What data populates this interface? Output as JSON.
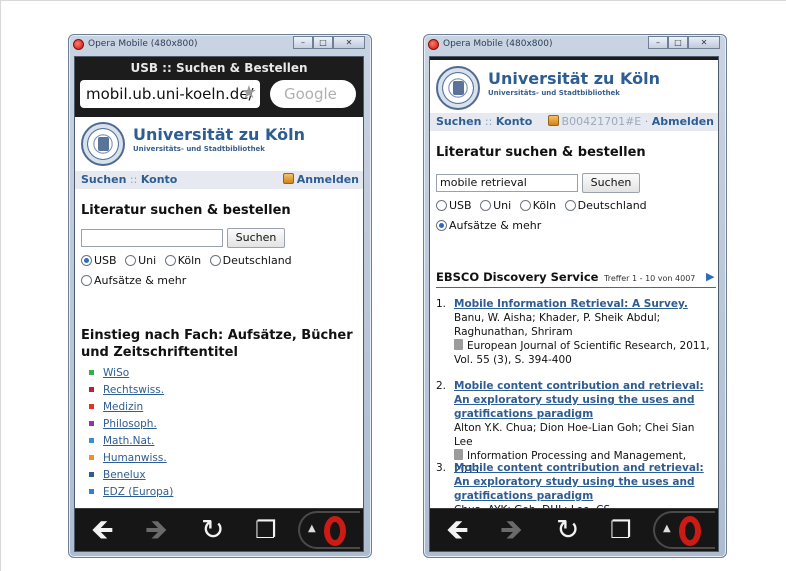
{
  "left_window": {
    "title": "Opera Mobile (480x800)",
    "controls": [
      "–",
      "□",
      "✕"
    ],
    "page_title": "USB :: Suchen & Bestellen",
    "url": "mobil.ub.uni-koeln.de/",
    "search_placeholder": "Google",
    "header": {
      "name": "Universität zu Köln",
      "subtitle": "Universitäts- und Stadtbibliothek"
    },
    "nav": {
      "suchen": "Suchen",
      "separator": "::",
      "konto": "Konto",
      "login": "Anmelden"
    },
    "search": {
      "heading": "Literatur suchen & bestellen",
      "input_value": "",
      "button": "Suchen",
      "options": [
        "USB",
        "Uni",
        "Köln",
        "Deutschland"
      ],
      "extra_option": "Aufsätze & mehr",
      "selected": "USB"
    },
    "subjects": {
      "heading": "Einstieg nach Fach: Aufsätze, Bücher und Zeitschriftentitel",
      "items": [
        {
          "label": "WiSo",
          "color": "#2eb24a"
        },
        {
          "label": "Rechtswiss.",
          "color": "#b3243a"
        },
        {
          "label": "Medizin",
          "color": "#e3322e"
        },
        {
          "label": "Philosoph.",
          "color": "#8a3a9c"
        },
        {
          "label": "Math.Nat.",
          "color": "#3b8fd1"
        },
        {
          "label": "Humanwiss.",
          "color": "#f0902a"
        },
        {
          "label": "Benelux",
          "color": "#2e5d93"
        },
        {
          "label": "EDZ (Europa)",
          "color": "#3b7bd1"
        }
      ]
    }
  },
  "right_window": {
    "title": "Opera Mobile (480x800)",
    "controls": [
      "–",
      "□",
      "✕"
    ],
    "header": {
      "name": "Universität zu Köln",
      "subtitle": "Universitäts- und Stadtbibliothek"
    },
    "nav": {
      "suchen": "Suchen",
      "separator": "::",
      "konto": "Konto",
      "user_id": "B00421701#E",
      "dot": "·",
      "logout": "Abmelden"
    },
    "search": {
      "heading": "Literatur suchen & bestellen",
      "input_value": "mobile retrieval",
      "button": "Suchen",
      "options": [
        "USB",
        "Uni",
        "Köln",
        "Deutschland"
      ],
      "extra_option": "Aufsätze & mehr",
      "selected": "Aufsätze & mehr"
    },
    "results": {
      "service": "EBSCO Discovery Service",
      "count": "Treffer 1 - 10 von 4007",
      "items": [
        {
          "num": "1.",
          "title": "Mobile Information Retrieval: A Survey.",
          "authors": "Banu, W. Aisha; Khader, P. Sheik Abdul; Raghunathan, Shriram",
          "source": "European Journal of Scientific Research, 2011, Vol. 55 (3), S. 394-400"
        },
        {
          "num": "2.",
          "title": "Mobile content contribution and retrieval: An exploratory study using the uses and gratifications paradigm",
          "authors": "Alton Y.K. Chua; Dion Hoe-Lian Goh; Chei Sian Lee",
          "source": "Information Processing and Management, 2011"
        },
        {
          "num": "3.",
          "title": "Mobile content contribution and retrieval: An exploratory study using the uses and gratifications paradigm",
          "authors": "Chua, AYK; Goh, DHL; Lee, CS",
          "source": ""
        }
      ]
    }
  },
  "toolbar": {
    "icons": [
      "back-arrow-icon",
      "forward-arrow-icon",
      "reload-icon",
      "tabs-icon",
      "opera-menu-icon"
    ]
  }
}
